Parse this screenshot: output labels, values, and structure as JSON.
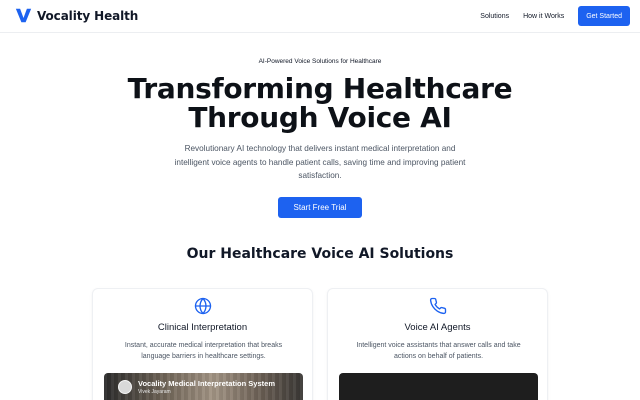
{
  "header": {
    "brand": "Vocality Health",
    "logo_icon": "v-logo-icon",
    "nav": [
      {
        "label": "Solutions"
      },
      {
        "label": "How it Works"
      }
    ],
    "cta_label": "Get Started"
  },
  "hero": {
    "eyebrow": "AI-Powered Voice Solutions for Healthcare",
    "title_line1": "Transforming Healthcare",
    "title_line2": "Through Voice AI",
    "subtitle": "Revolutionary AI technology that delivers instant medical interpretation and intelligent voice agents to handle patient calls, saving time and improving patient satisfaction.",
    "cta_label": "Start Free Trial"
  },
  "solutions": {
    "title": "Our Healthcare Voice AI Solutions",
    "cards": [
      {
        "icon": "globe-icon",
        "title": "Clinical Interpretation",
        "description": "Instant, accurate medical interpretation that breaks language barriers in healthcare settings.",
        "video_title": "Vocality Medical Interpretation System",
        "video_author": "Vivek Jayaram"
      },
      {
        "icon": "phone-icon",
        "title": "Voice AI Agents",
        "description": "Intelligent voice assistants that answer calls and take actions on behalf of patients."
      }
    ]
  },
  "colors": {
    "accent": "#1d62f0",
    "heading": "#0d1117",
    "body_text": "#4b5563"
  }
}
